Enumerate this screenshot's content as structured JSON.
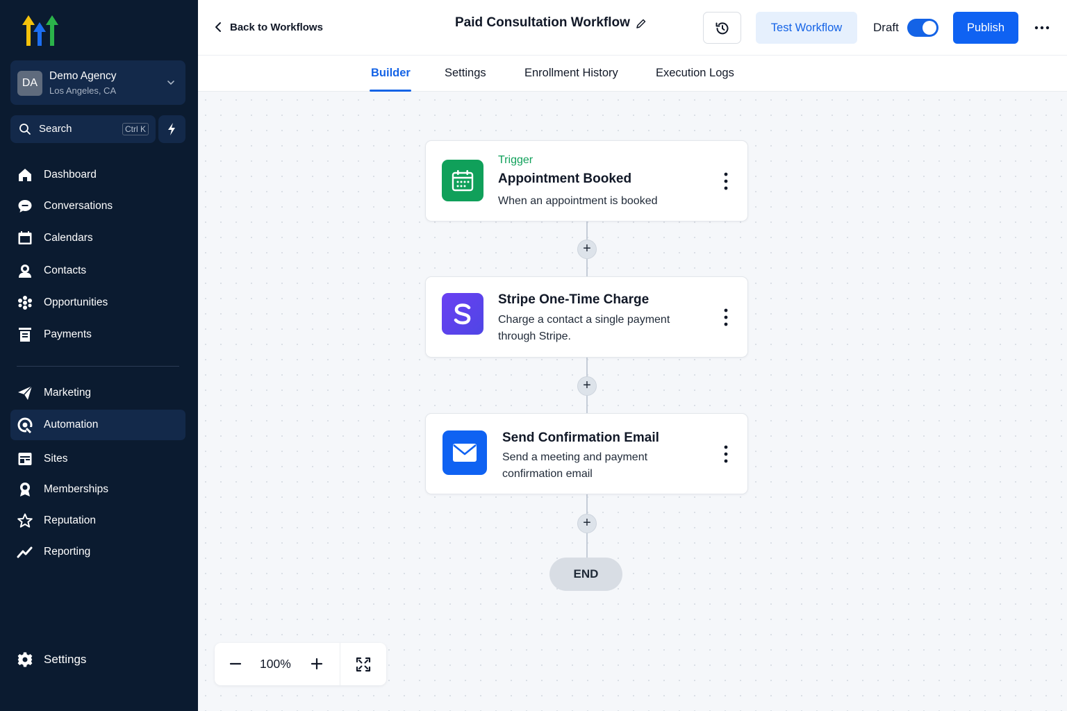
{
  "sidebar": {
    "account": {
      "initials": "DA",
      "name": "Demo Agency",
      "location": "Los Angeles, CA"
    },
    "search": {
      "label": "Search",
      "shortcut": "Ctrl K"
    },
    "items": [
      {
        "label": "Dashboard",
        "icon": "home-icon"
      },
      {
        "label": "Conversations",
        "icon": "chat-icon"
      },
      {
        "label": "Calendars",
        "icon": "calendar-icon"
      },
      {
        "label": "Contacts",
        "icon": "contacts-icon"
      },
      {
        "label": "Opportunities",
        "icon": "opportunities-icon"
      },
      {
        "label": "Payments",
        "icon": "payments-icon"
      },
      {
        "label": "Marketing",
        "icon": "send-icon"
      },
      {
        "label": "Automation",
        "icon": "automation-icon",
        "active": true
      },
      {
        "label": "Sites",
        "icon": "sites-icon"
      },
      {
        "label": "Memberships",
        "icon": "badge-icon"
      },
      {
        "label": "Reputation",
        "icon": "star-icon"
      },
      {
        "label": "Reporting",
        "icon": "trend-icon"
      }
    ],
    "settings_label": "Settings"
  },
  "header": {
    "back_label": "Back to Workflows",
    "title": "Paid Consultation Workflow",
    "test_label": "Test Workflow",
    "draft_label": "Draft",
    "draft_enabled": true,
    "publish_label": "Publish"
  },
  "tabs": [
    {
      "label": "Builder",
      "active": true
    },
    {
      "label": "Settings"
    },
    {
      "label": "Enrollment History"
    },
    {
      "label": "Execution Logs"
    }
  ],
  "workflow": {
    "trigger": {
      "tag": "Trigger",
      "title": "Appointment Booked",
      "description": "When an appointment is booked"
    },
    "actions": [
      {
        "title": "Stripe One-Time Charge",
        "description_line1": "Charge a contact a single payment",
        "description_line2": "through Stripe."
      },
      {
        "title": "Send Confirmation Email",
        "description_line1": "Send a meeting and payment",
        "description_line2": "confirmation email"
      }
    ],
    "end_label": "END"
  },
  "zoom": {
    "level": "100%"
  },
  "colors": {
    "sidebar_bg": "#0b1b30",
    "sidebar_active": "#13294a",
    "accent": "#1463e6",
    "trigger_green": "#10a05a",
    "stripe_purple": "#5b3ff0",
    "email_blue": "#0f62f2"
  }
}
